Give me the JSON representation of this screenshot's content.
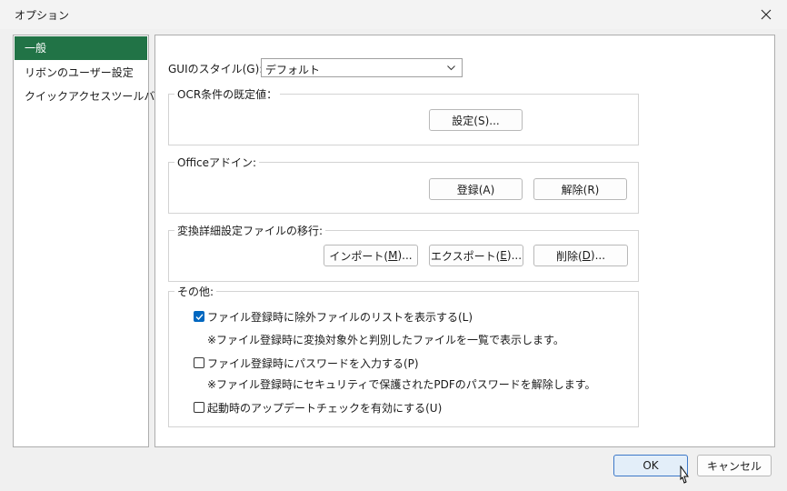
{
  "window": {
    "title": "オプション"
  },
  "sidebar": {
    "items": [
      {
        "label": "一般",
        "active": true
      },
      {
        "label": "リボンのユーザー設定",
        "active": false
      },
      {
        "label": "クイックアクセスツールバー",
        "active": false
      }
    ]
  },
  "general": {
    "gui_style_label": "GUIのスタイル(G):",
    "gui_style_value": "デフォルト",
    "ocr": {
      "title": "OCR条件の既定値：",
      "settings_button": "設定(S)..."
    },
    "office": {
      "title": "Officeアドイン:",
      "register_button": "登録(A)",
      "unregister_button": "解除(R)"
    },
    "migration": {
      "title": "変換詳細設定ファイルの移行:",
      "import_pre": "インポート(",
      "import_key": "M",
      "import_post": ")...",
      "export_pre": "エクスポート(",
      "export_key": "E",
      "export_post": ")...",
      "delete_pre": "削除(",
      "delete_key": "D",
      "delete_post": ")..."
    },
    "other": {
      "title": "その他:",
      "options": [
        {
          "label": "ファイル登録時に除外ファイルのリストを表示する(L)",
          "checked": true,
          "note": "※ファイル登録時に変換対象外と判別したファイルを一覧で表示します。"
        },
        {
          "label": "ファイル登録時にパスワードを入力する(P)",
          "checked": false,
          "note": "※ファイル登録時にセキュリティで保護されたPDFのパスワードを解除します。"
        },
        {
          "label": "起動時のアップデートチェックを有効にする(U)",
          "checked": false
        }
      ]
    }
  },
  "footer": {
    "ok_label": "OK",
    "cancel_label": "キャンセル"
  },
  "colors": {
    "accent": "#217346",
    "checkbox": "#0067c0",
    "primary_button_bg": "#e3eef9"
  }
}
